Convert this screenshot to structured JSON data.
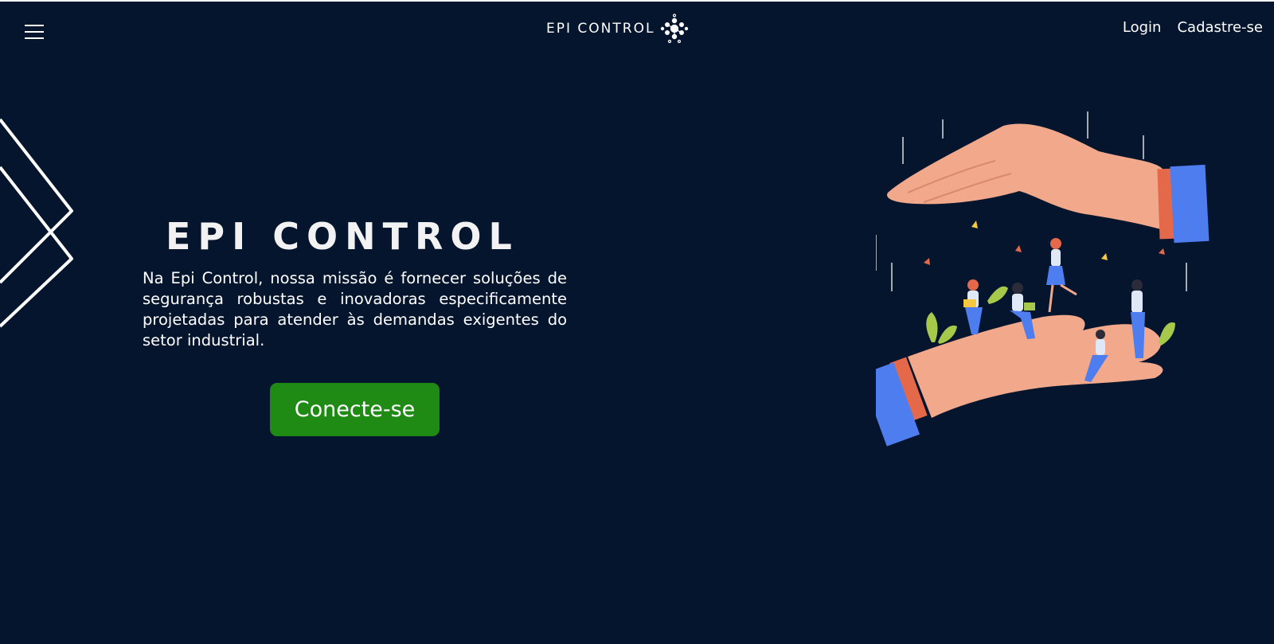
{
  "header": {
    "brand": "EPI CONTROL",
    "links": {
      "login": "Login",
      "signup": "Cadastre-se"
    },
    "menu_icon": "hamburger-menu-icon",
    "logo_icon": "molecule-network-icon"
  },
  "hero": {
    "title": "EPI CONTROL",
    "description": "Na Epi Control, nossa missão é fornecer soluções de segurança robustas e inovadoras especificamente projetadas para atender às demandas exigentes do setor industrial.",
    "cta_label": "Conecte-se",
    "illustration": "hands-protecting-people-illustration"
  },
  "colors": {
    "background": "#05152e",
    "cta": "#1f8a14",
    "text": "#ffffff"
  }
}
